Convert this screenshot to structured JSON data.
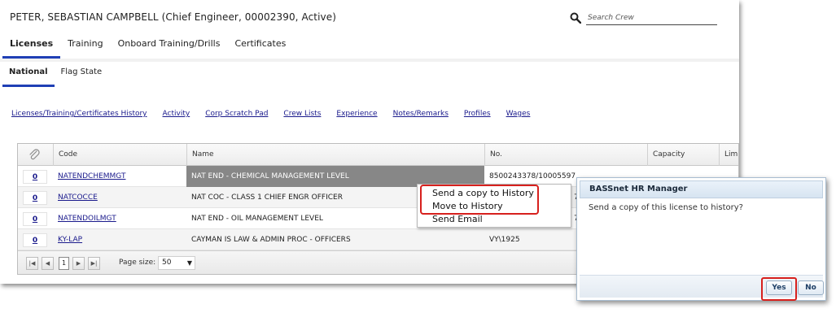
{
  "header": {
    "crew_title": "PETER, SEBASTIAN CAMPBELL (Chief Engineer, 00002390, Active)",
    "search_placeholder": "Search Crew"
  },
  "main_tabs": [
    {
      "label": "Licenses",
      "active": true
    },
    {
      "label": "Training",
      "active": false
    },
    {
      "label": "Onboard Training/Drills",
      "active": false
    },
    {
      "label": "Certificates",
      "active": false
    }
  ],
  "sub_tabs": [
    {
      "label": "National",
      "active": true
    },
    {
      "label": "Flag State",
      "active": false
    }
  ],
  "links": [
    "Licenses/Training/Certificates History",
    "Activity",
    "Corp Scratch Pad",
    "Crew Lists",
    "Experience",
    "Notes/Remarks",
    "Profiles",
    "Wages"
  ],
  "grid": {
    "columns": [
      "Code",
      "Name",
      "No.",
      "Capacity",
      "Lim"
    ],
    "rows": [
      {
        "count": "0",
        "code": "NATENDCHEMMGT",
        "name": "NAT END - CHEMICAL MANAGEMENT LEVEL",
        "no": "8500243378/10005597",
        "selected": true
      },
      {
        "count": "0",
        "code": "NATCOCCE",
        "name": "NAT COC - CLASS 1 CHIEF ENGR OFFICER",
        "no": "",
        "selected": false
      },
      {
        "count": "0",
        "code": "NATENDOILMGT",
        "name": "NAT END - OIL MANAGEMENT LEVEL",
        "no": "",
        "selected": false
      },
      {
        "count": "0",
        "code": "KY-LAP",
        "name": "CAYMAN IS LAW & ADMIN PROC - OFFICERS",
        "no": "VY\\1925",
        "selected": false
      }
    ],
    "hidden_no_fragments": [
      "7",
      "7"
    ],
    "pager": {
      "first": "|◀",
      "prev": "◀",
      "current_page": "1",
      "next": "▶",
      "last": "▶|",
      "page_size_label": "Page size:",
      "page_size_value": "50"
    }
  },
  "context_menu": {
    "items": [
      "Send a copy to History",
      "Move to History",
      "Send Email"
    ]
  },
  "dialog": {
    "title": "BASSnet HR Manager",
    "message": "Send a copy of this license to history?",
    "yes_label": "Yes",
    "no_label": "No"
  },
  "colors": {
    "tab_underline": "#1f3fb5",
    "link": "#1a1a8c",
    "highlight_red": "#d7201d",
    "selected_row": "#878787"
  }
}
